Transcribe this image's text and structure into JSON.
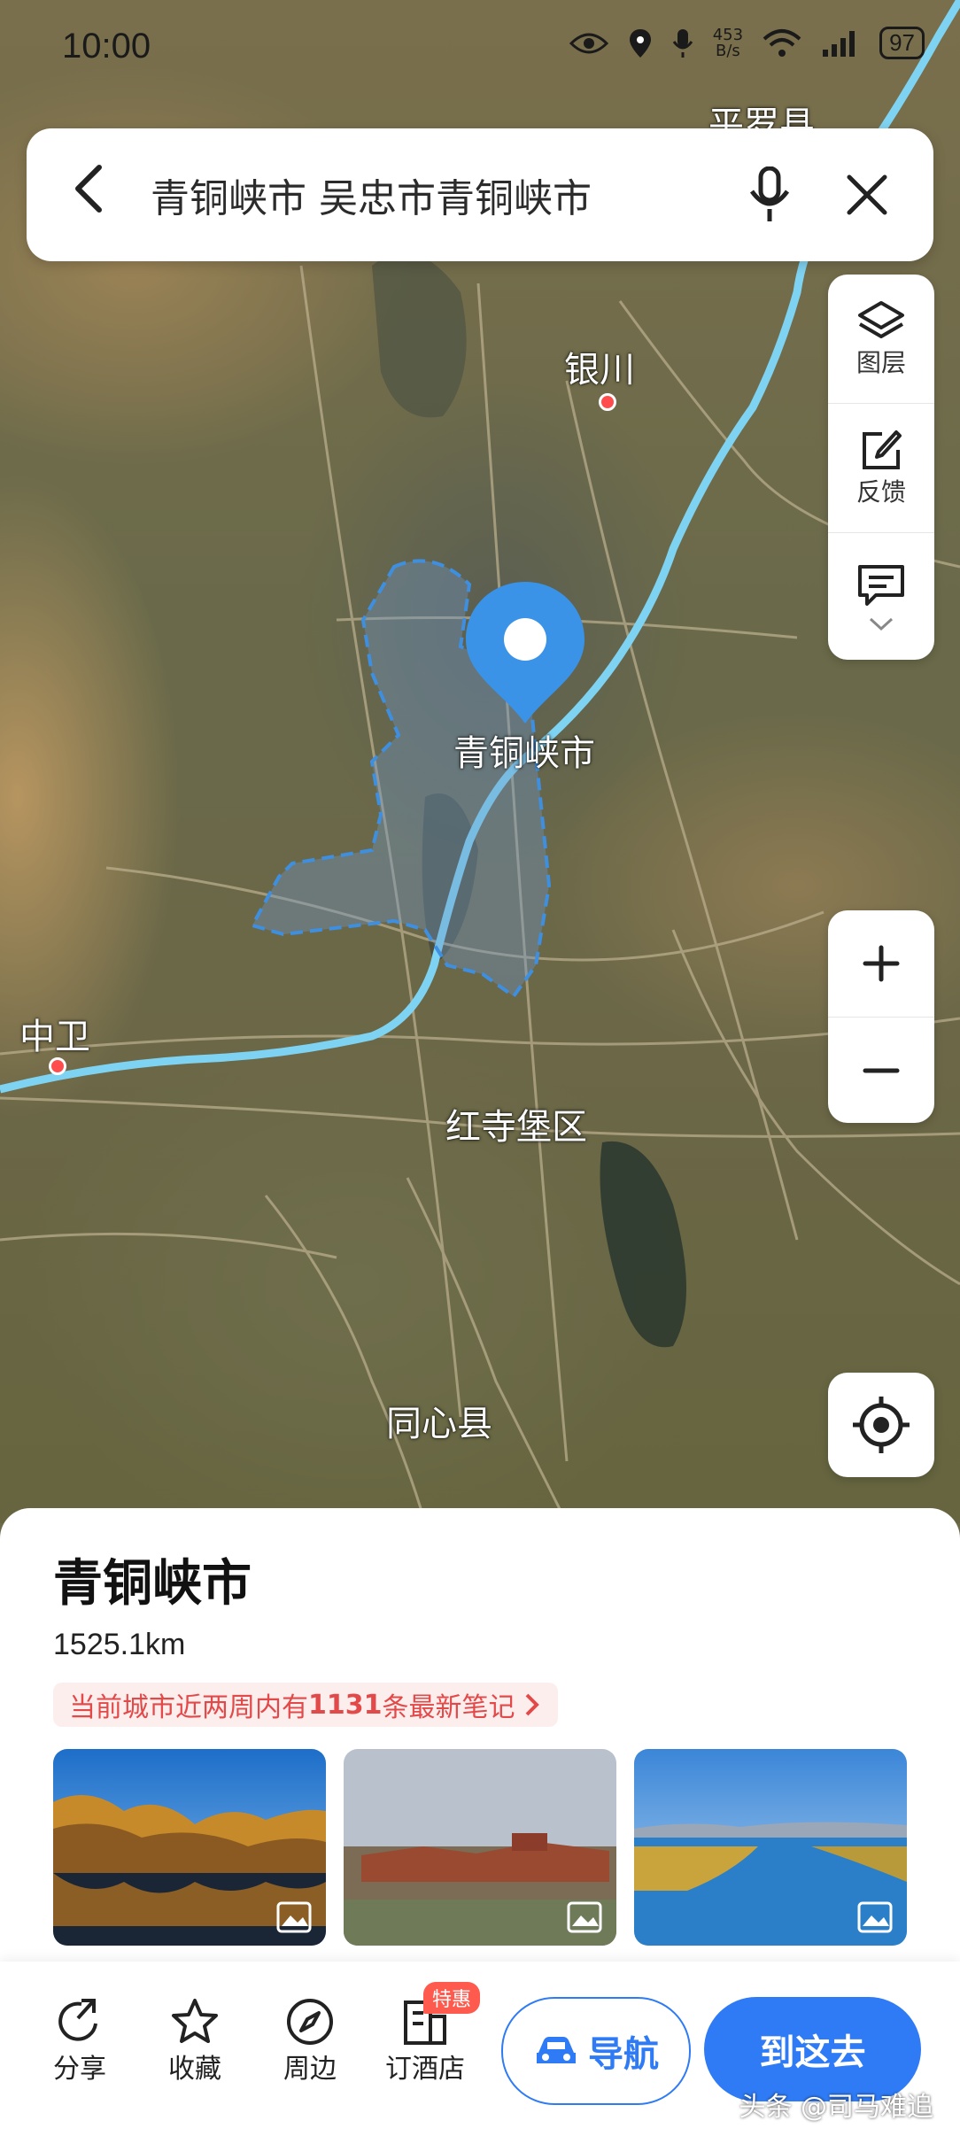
{
  "status_bar": {
    "time": "10:00",
    "net_speed_value": "453",
    "net_speed_unit": "B/s",
    "battery": "97"
  },
  "search": {
    "query": "青铜峡市 吴忠市青铜峡市"
  },
  "side_panel": {
    "layers_label": "图层",
    "feedback_label": "反馈"
  },
  "map_labels": {
    "pingluo": "平罗县",
    "yinchuan": "银川",
    "qingtongxia": "青铜峡市",
    "zhongwei": "中卫",
    "hongsibao": "红寺堡区",
    "tongxin": "同心县"
  },
  "place": {
    "name": "青铜峡市",
    "distance": "1525.1km",
    "notes_prefix": "当前城市近两周内有",
    "notes_count": "1131",
    "notes_suffix": "条最新笔记"
  },
  "actions": {
    "share": "分享",
    "favorite": "收藏",
    "nearby": "周边",
    "hotel": "订酒店",
    "hotel_badge": "特惠",
    "navigate": "导航",
    "go_here": "到这去"
  },
  "watermark": "头条 @司马难追",
  "colors": {
    "accent": "#2f7bf5",
    "river": "#7fd3f2",
    "boundary": "#3f8fe0",
    "notes_red": "#e24a4a"
  }
}
